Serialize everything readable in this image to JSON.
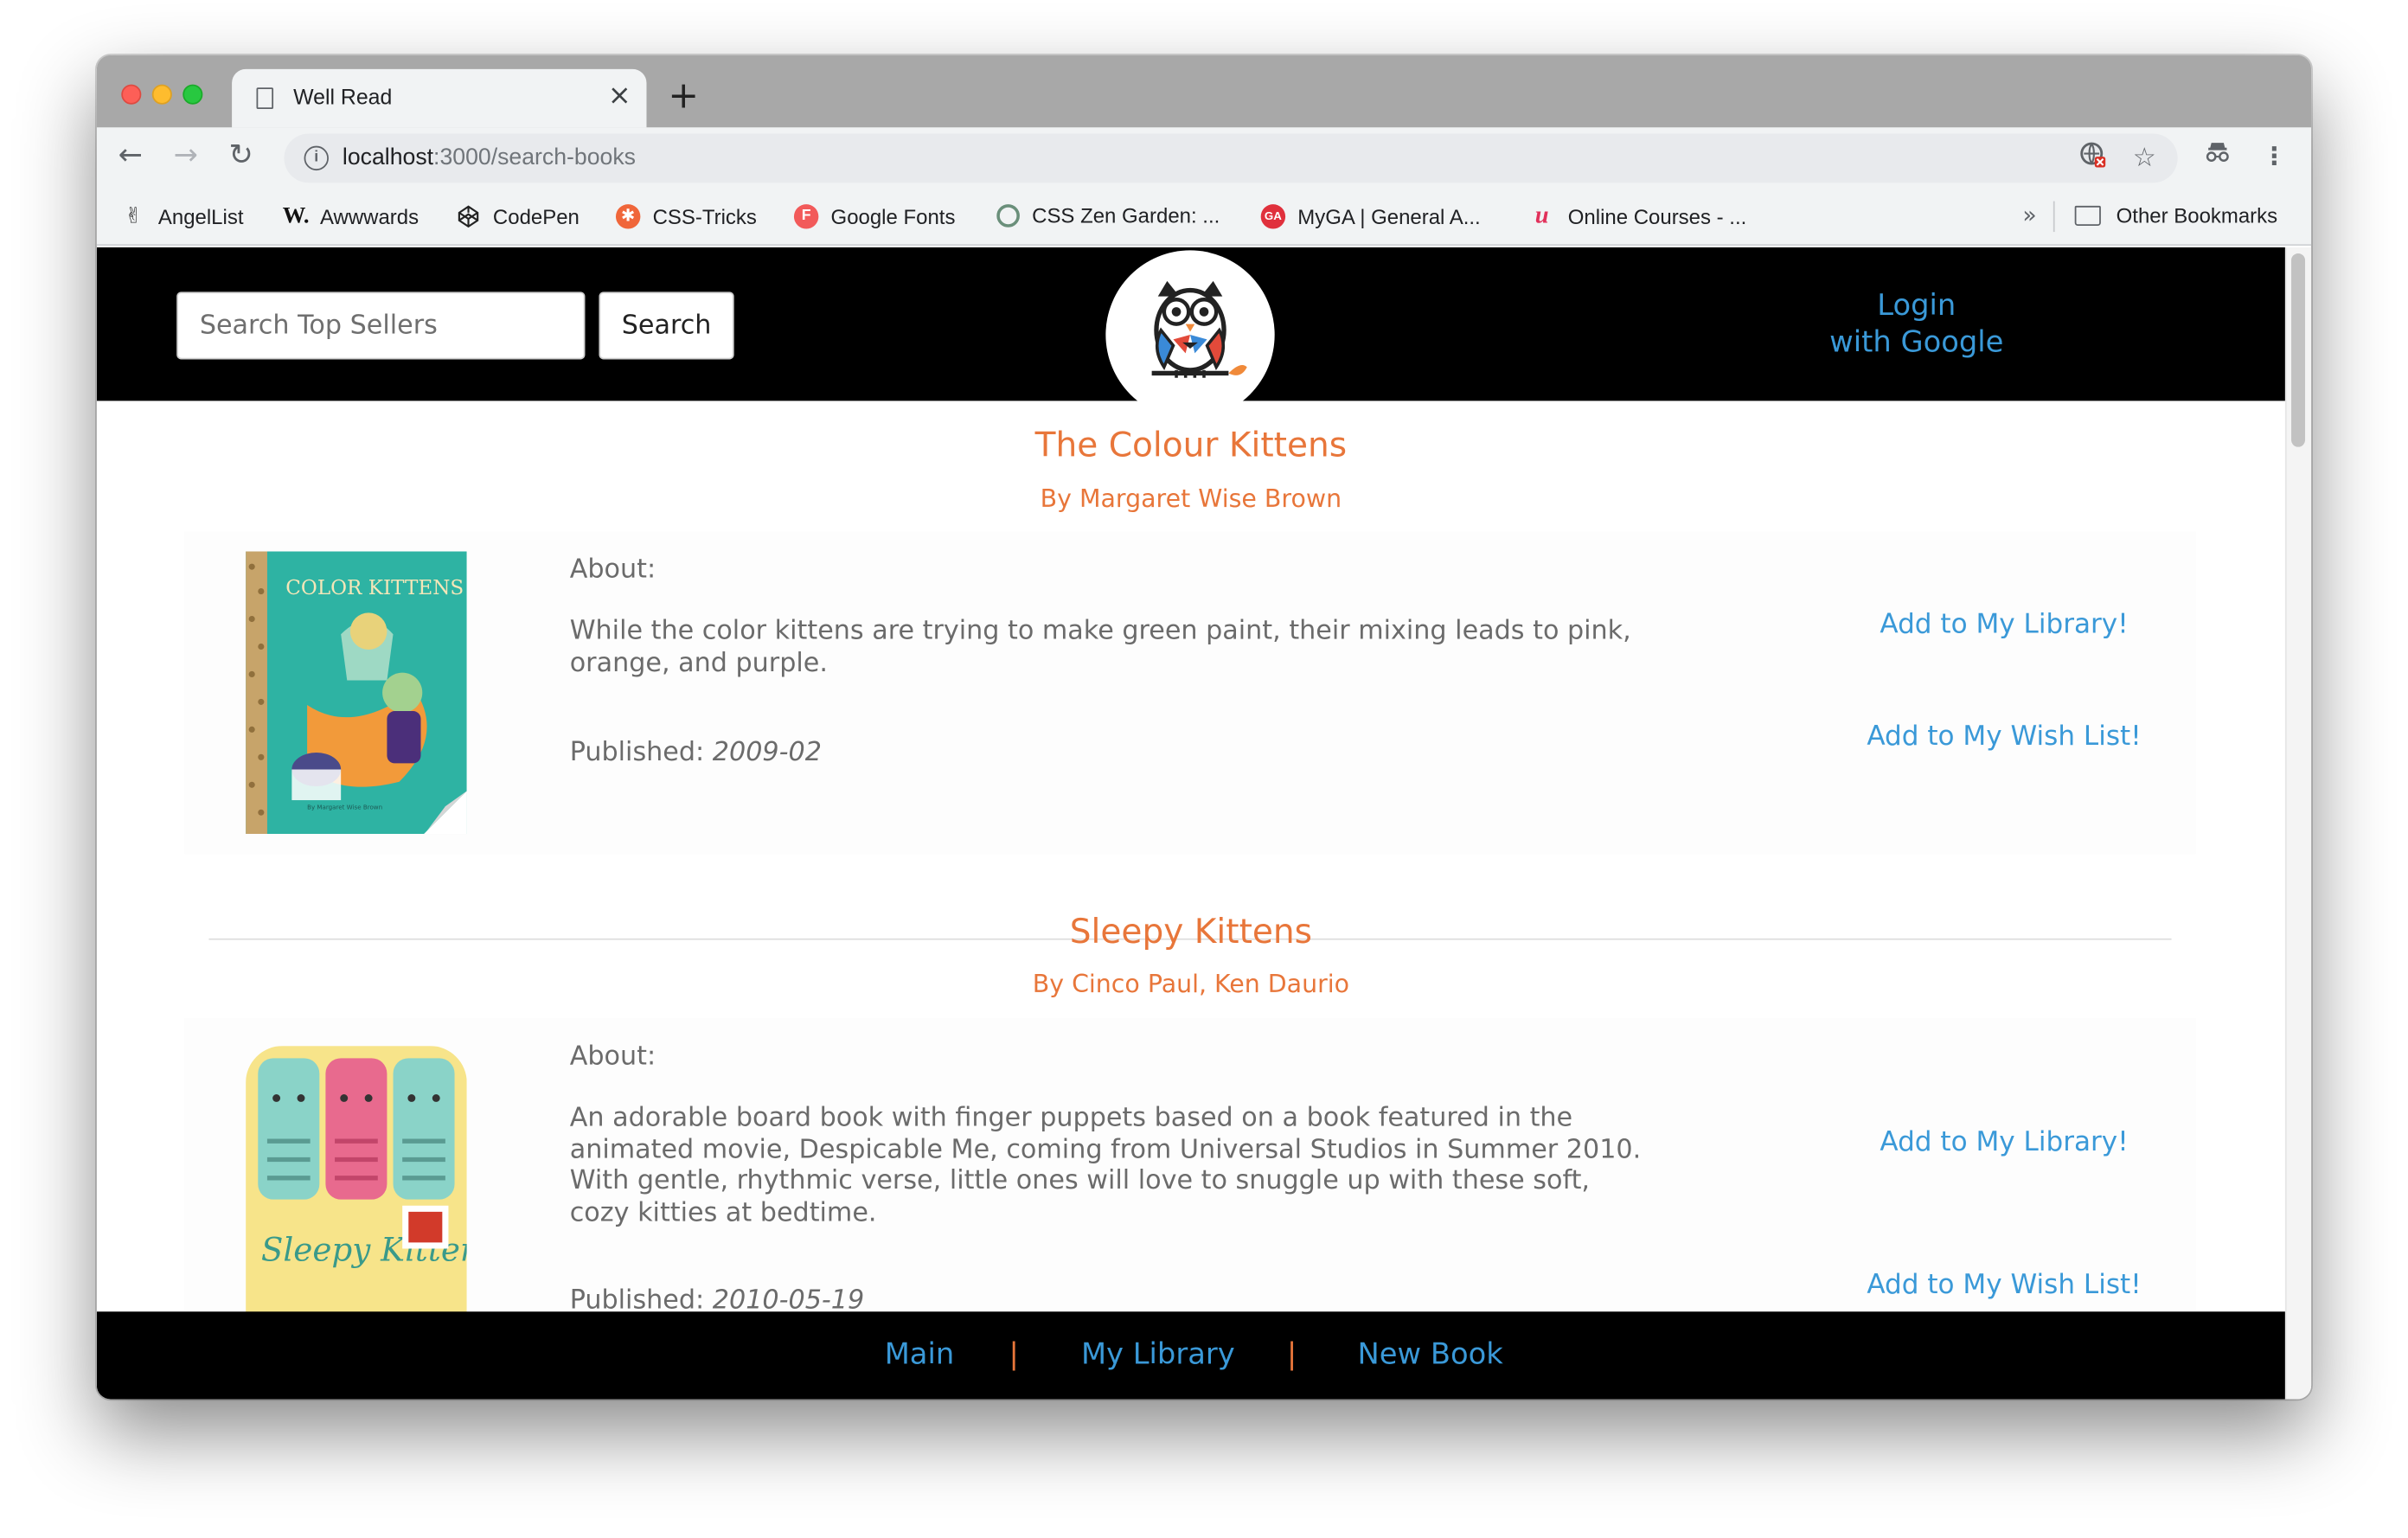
{
  "browser": {
    "tab_title": "Well Read",
    "tab_close": "×",
    "new_tab": "+",
    "url_host": "localhost",
    "url_path": ":3000/search-books",
    "bookmarks": [
      {
        "label": "AngelList",
        "icon": "peace-hand-icon"
      },
      {
        "label": "Awwwards",
        "icon": "awwwards-w-icon"
      },
      {
        "label": "CodePen",
        "icon": "codepen-cube-icon"
      },
      {
        "label": "CSS-Tricks",
        "icon": "css-tricks-star-icon"
      },
      {
        "label": "Google Fonts",
        "icon": "google-fonts-f-icon"
      },
      {
        "label": "CSS Zen Garden: ...",
        "icon": "zen-garden-circle-icon"
      },
      {
        "label": "MyGA | General A...",
        "icon": "ga-badge-icon"
      },
      {
        "label": "Online Courses - ...",
        "icon": "udemy-u-icon"
      }
    ],
    "bookmarks_overflow": "»",
    "other_bookmarks": "Other Bookmarks"
  },
  "header": {
    "search_placeholder": "Search Top Sellers",
    "search_button": "Search",
    "login_line1": "Login",
    "login_line2": "with Google"
  },
  "books": [
    {
      "title": "The Colour Kittens",
      "author": "By Margaret Wise Brown",
      "about_label": "About:",
      "description": "While the color kittens are trying to make green paint, their mixing leads to pink, orange, and purple.",
      "published_label": "Published:",
      "published_date": "2009-02",
      "add_library": "Add to My Library!",
      "add_wishlist": "Add to My Wish List!",
      "cover_text": "COLOR KITTENS"
    },
    {
      "title": "Sleepy Kittens",
      "author": "By Cinco Paul, Ken Daurio",
      "about_label": "About:",
      "description": "An adorable board book with finger puppets based on a book featured in the animated movie, Despicable Me, coming from Universal Studios in Summer 2010. With gentle, rhythmic verse, little ones will love to snuggle up with these soft, cozy kitties at bedtime.",
      "published_label": "Published:",
      "published_date": "2010-05-19",
      "add_library": "Add to My Library!",
      "add_wishlist": "Add to My Wish List!",
      "cover_text": "Sleepy Kittens"
    }
  ],
  "footer": {
    "links": [
      "Main",
      "My Library",
      "New Book"
    ],
    "separator": "|"
  },
  "colors": {
    "accent_orange": "#e8763a",
    "link_blue": "#3a99d8",
    "bar_black": "#000000"
  }
}
